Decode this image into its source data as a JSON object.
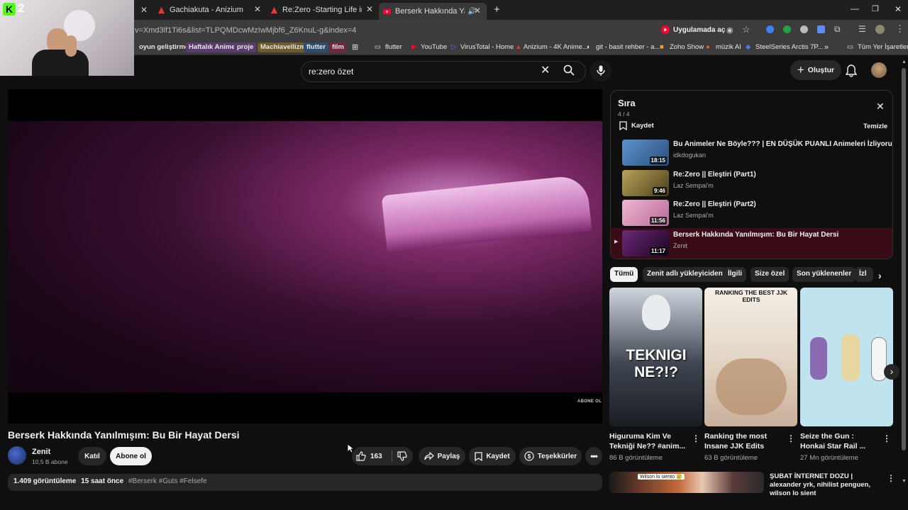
{
  "browser": {
    "tabs": [
      {
        "label": ""
      },
      {
        "label": "Gachiakuta - Anizium"
      },
      {
        "label": "Re:Zero -Starting Life in Anothe"
      },
      {
        "label": "Berserk Hakkında Yanılmışı"
      }
    ],
    "url": "v=Xmd3lf1Ti6s&list=TLPQMDcwMzIwMjbf6_Z6KnuL-g&index=4",
    "open_in_app": "Uygulamada aç",
    "bookmarks": [
      {
        "label": "oyun geliştirme"
      },
      {
        "label": "Haftalık Anime"
      },
      {
        "label": "proje"
      },
      {
        "label": "Machiavellizm"
      },
      {
        "label": "flutter"
      },
      {
        "label": "film"
      },
      {
        "label": "flutter"
      },
      {
        "label": "YouTube"
      },
      {
        "label": "VirusTotal - Home"
      },
      {
        "label": "Anizium - 4K Anime..."
      },
      {
        "label": "git - basit rehber - a..."
      },
      {
        "label": "Zoho Show"
      },
      {
        "label": "müzik AI"
      },
      {
        "label": "SteelSeries Arctis 7P..."
      }
    ],
    "all_bookmarks": "Tüm Yer İşaretleri",
    "more": "»"
  },
  "overlay": {
    "badge_number": "2"
  },
  "youtube": {
    "search_value": "re:zero özet",
    "create_label": "Oluştur"
  },
  "player": {
    "watermark": "ABONE OL"
  },
  "video": {
    "title": "Berserk Hakkında Yanılmışım: Bu Bir Hayat Dersi",
    "channel": "Zenit",
    "subscribers": "10,5 B abone",
    "join_label": "Katıl",
    "subscribe_label": "Abone ol",
    "like_count": "163",
    "share_label": "Paylaş",
    "save_label": "Kaydet",
    "thanks_label": "Teşekkürler",
    "description": {
      "views": "1.409 görüntüleme",
      "time": "15 saat önce",
      "tags": "#Berserk #Guts #Felsefe"
    }
  },
  "queue": {
    "title": "Sıra",
    "position": "4 / 4",
    "save_label": "Kaydet",
    "clear_label": "Temizle",
    "items": [
      {
        "title": "Bu Animeler Ne Böyle??? | EN DÜŞÜK PUANLI Animeleri İzliyorum",
        "channel": "idkdogukan",
        "duration": "18:15",
        "color": "#4a7fb8"
      },
      {
        "title": "Re:Zero || Eleştiri (Part1)",
        "channel": "Laz Sempai'm",
        "duration": "9:46",
        "color": "#7a6a2a"
      },
      {
        "title": "Re:Zero || Eleştiri (Part2)",
        "channel": "Laz Sempai'm",
        "duration": "11:56",
        "color": "#d48aa8"
      },
      {
        "title": "Berserk Hakkında Yanılmışım: Bu Bir Hayat Dersi",
        "channel": "Zenit",
        "duration": "11:17",
        "color": "#4a1650",
        "playing_marker": "▶"
      }
    ]
  },
  "chips": [
    "Tümü",
    "Zenit adlı yükleyiciden",
    "İlgili",
    "Size özel",
    "Son yüklenenler",
    "İzl"
  ],
  "shorts": [
    {
      "title": "Higuruma Kim Ve Tekniği Ne?? #anim...",
      "views": "86 B görüntüleme",
      "overlay_text": "TEKNIGI NE?!?"
    },
    {
      "title": "Ranking the most Insane JJK Edits",
      "views": "63 B görüntüleme",
      "overlay_text": "RANKING THE BEST JJK EDITS"
    },
    {
      "title": "Seize the Gun : Honkai Star Rail ...",
      "views": "27 Mn görüntüleme",
      "overlay_text": ""
    }
  ],
  "next_video": {
    "title": "ŞUBAT İNTERNET DOZU | alexander yrk, nihilist penguen, wilson lo sient",
    "thumb_caption": "Wilson lo siento 😢"
  },
  "colors": {
    "accent": "#ff0033",
    "bg": "#0f0f0f",
    "surface": "#272727"
  }
}
